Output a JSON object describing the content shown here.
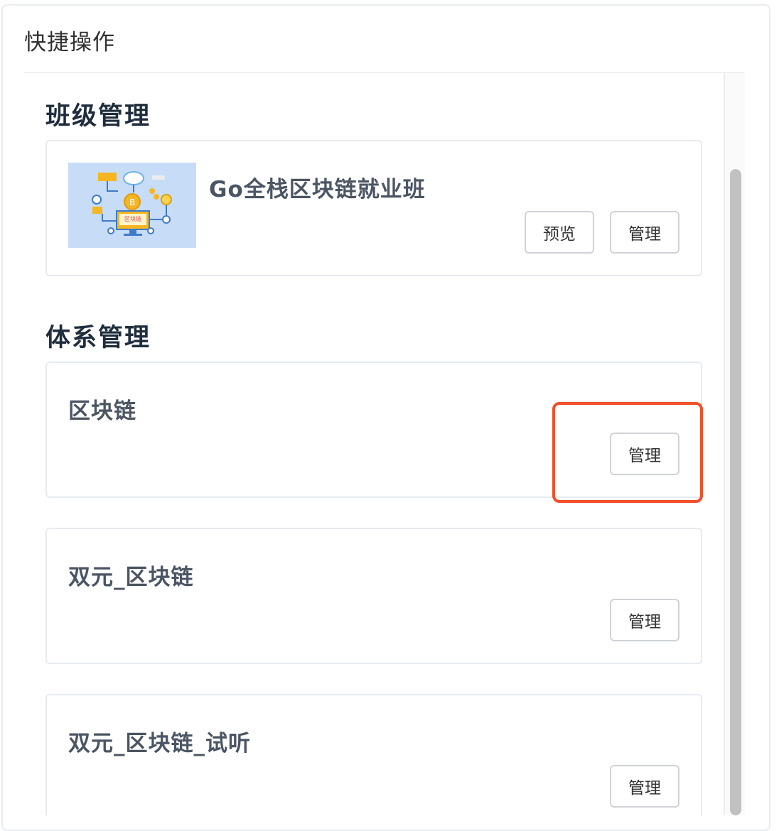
{
  "panel": {
    "title": "快捷操作"
  },
  "class_section": {
    "title": "班级管理",
    "card": {
      "image_label": "区块链",
      "name": "Go全栈区块链就业班",
      "preview_label": "预览",
      "manage_label": "管理"
    }
  },
  "system_section": {
    "title": "体系管理",
    "items": [
      {
        "name": "区块链",
        "manage_label": "管理"
      },
      {
        "name": "双元_区块链",
        "manage_label": "管理"
      },
      {
        "name": "双元_区块链_试听",
        "manage_label": "管理"
      }
    ]
  },
  "colors": {
    "highlight": "#f0502a",
    "section_title": "#1f2d3d",
    "card_border": "#e6ebf0"
  }
}
